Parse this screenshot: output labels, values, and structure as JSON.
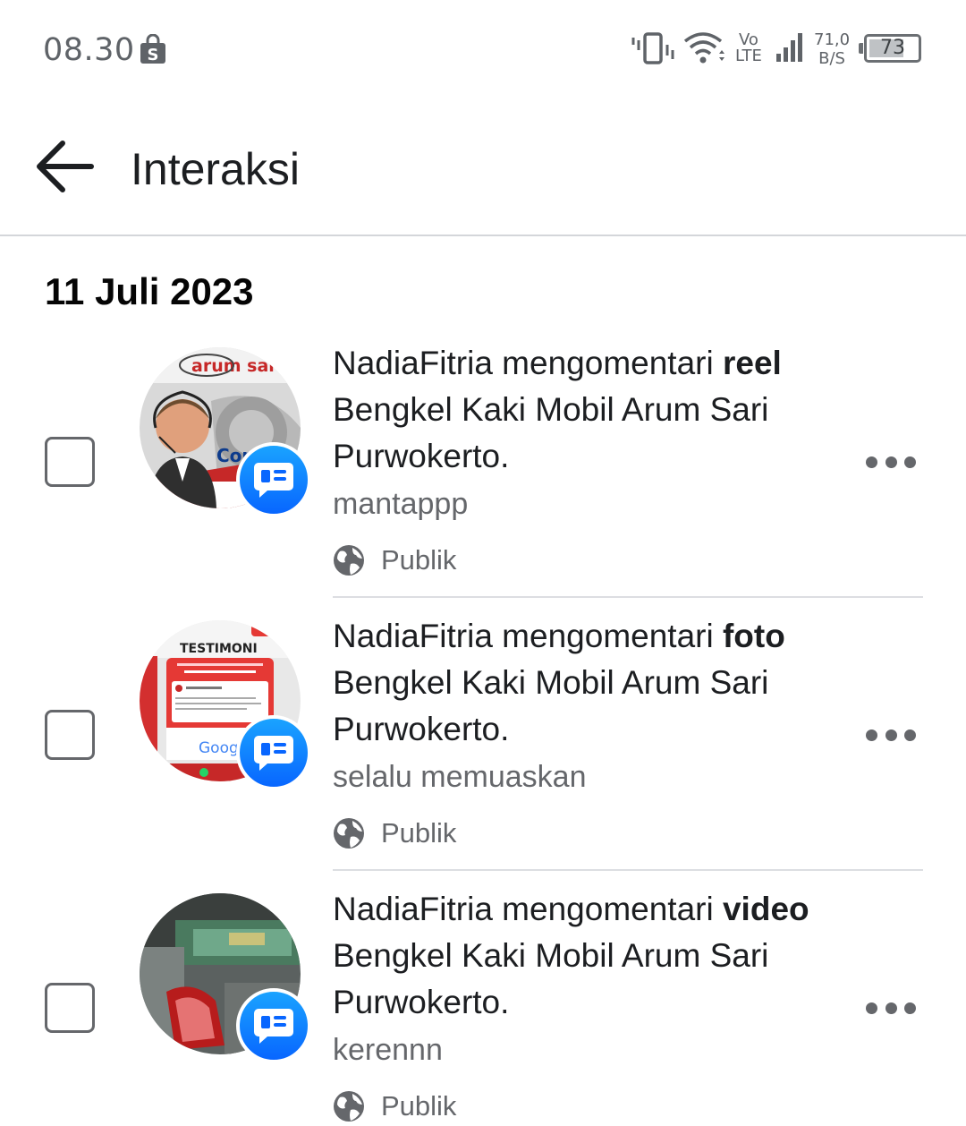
{
  "status_bar": {
    "time": "08.30",
    "volte_line1": "Vo",
    "volte_line2": "LTE",
    "speed_value": "71,0",
    "speed_unit": "B/S",
    "battery": "73",
    "battery_fraction": 0.73,
    "icons": [
      "shopping-bag-icon",
      "vibrate-icon",
      "wifi-icon",
      "signal-icon",
      "battery-icon"
    ]
  },
  "header": {
    "title": "Interaksi"
  },
  "date": "11 Juli 2023",
  "items": [
    {
      "actor": "NadiaFitria",
      "verb": " mengomentari ",
      "object": "reel",
      "target": " Bengkel Kaki Mobil Arum Sari Purwokerto.",
      "comment": "mantappp",
      "privacy": "Publik",
      "thumb_brand": "arum sari",
      "thumb_caption": "Cont"
    },
    {
      "actor": "NadiaFitria",
      "verb": " mengomentari ",
      "object": "foto",
      "target": " Bengkel Kaki Mobil Arum Sari Purwokerto.",
      "comment": "selalu memuaskan",
      "privacy": "Publik",
      "thumb_brand": "TESTIMONI",
      "thumb_caption": "Googl"
    },
    {
      "actor": "NadiaFitria",
      "verb": " mengomentari ",
      "object": "video",
      "target": " Bengkel Kaki Mobil Arum Sari Purwokerto.",
      "comment": "kerennn",
      "privacy": "Publik"
    }
  ],
  "colors": {
    "accent_blue": "#0866ff",
    "secondary_text": "#65676b",
    "divider": "#dcdee2"
  }
}
